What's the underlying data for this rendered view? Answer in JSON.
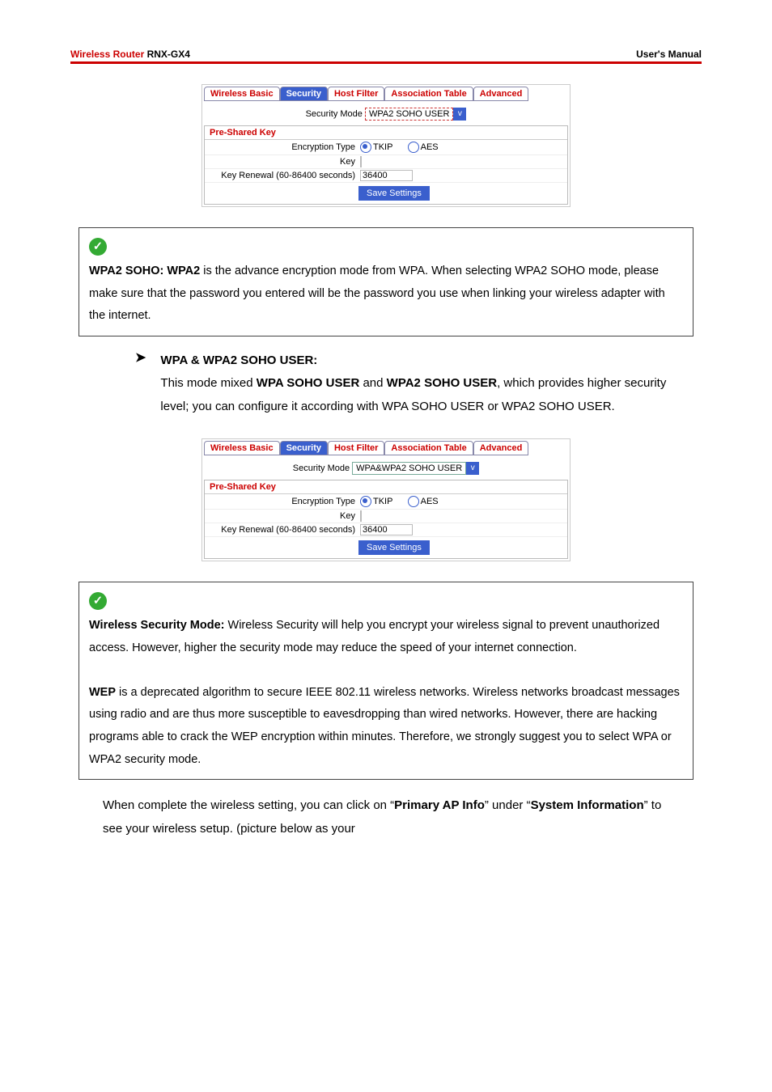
{
  "header": {
    "left_red": "Wireless Router",
    "left_black": " RNX-GX4",
    "right": "User's Manual"
  },
  "tabs": {
    "t1": "Wireless Basic",
    "t2": "Security",
    "t3": "Host Filter",
    "t4": "Association Table",
    "t5": "Advanced"
  },
  "shot1": {
    "sec_mode_label": "Security Mode",
    "sec_mode_value": "WPA2 SOHO USER",
    "psk_heading": "Pre-Shared Key",
    "enc_label": "Encryption Type",
    "enc_tkip": "TKIP",
    "enc_aes": "AES",
    "key_label": "Key",
    "renewal_label": "Key Renewal (60-86400 seconds)",
    "renewal_value": "36400",
    "save": "Save Settings"
  },
  "note1": {
    "bold1": "WPA2 SOHO: WPA2",
    "txt": " is the advance encryption mode from WPA. When selecting WPA2 SOHO mode, please make sure that the password you entered will be the password you use when linking your wireless adapter with the internet."
  },
  "bullet": {
    "title": "WPA & WPA2 SOHO USER:",
    "l1a": "This mode mixed ",
    "l1b": "WPA SOHO USER",
    "l1c": " and ",
    "l1d": "WPA2 SOHO USER",
    "l1e": ", which provides higher security level; you can configure it according with WPA SOHO USER or WPA2 SOHO USER."
  },
  "shot2": {
    "sec_mode_value": "WPA&WPA2 SOHO USER"
  },
  "note2": {
    "bold1": "Wireless Security Mode:",
    "p1": " Wireless Security will help you encrypt your wireless signal to prevent unauthorized access. However, higher the security mode may reduce the speed of your internet connection.",
    "bold2": "WEP",
    "p2": " is a deprecated algorithm to secure IEEE 802.11 wireless networks. Wireless networks broadcast messages using radio and are thus more susceptible to eavesdropping than wired networks. However, there are hacking programs able to crack the WEP encryption within minutes. Therefore, we strongly suggest you to select WPA or WPA2 security mode."
  },
  "closing": {
    "a": "When complete the wireless setting, you can click on “",
    "b": "Primary AP Info",
    "c": "” under “",
    "d": "System Information",
    "e": "” to see your wireless setup. (picture below as your"
  }
}
